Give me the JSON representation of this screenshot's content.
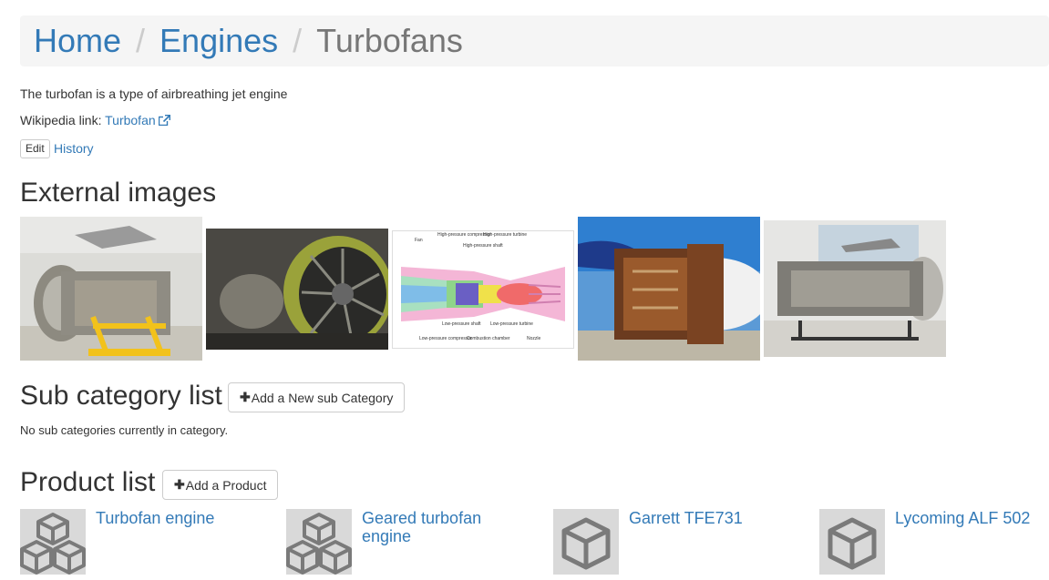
{
  "breadcrumb": {
    "home": "Home",
    "engines": "Engines",
    "separator": "/",
    "current": "Turbofans"
  },
  "description": "The turbofan is a type of airbreathing jet engine",
  "wikipedia": {
    "label": "Wikipedia link:",
    "link_text": "Turbofan",
    "icon": "external-link-icon"
  },
  "actions": {
    "edit": "Edit",
    "history": "History"
  },
  "external_images": {
    "heading": "External images",
    "images": [
      {
        "name": "turbofan-engine-photo-1"
      },
      {
        "name": "turbofan-fan-photo"
      },
      {
        "name": "turbofan-diagram",
        "labels": {
          "fan": "Fan",
          "hpc": "High-pressure compressor",
          "hps": "High-pressure shaft",
          "hpt": "High-pressure turbine",
          "lps": "Low-pressure shaft",
          "lpc": "Low-pressure compressor",
          "cc": "Combustion chamber",
          "lpt": "Low-pressure turbine",
          "nozzle": "Nozzle"
        }
      },
      {
        "name": "engine-on-aircraft-photo"
      },
      {
        "name": "turbofan-engine-photo-2"
      }
    ]
  },
  "sub_category": {
    "heading": "Sub category list",
    "add_button": "Add a New sub Category",
    "empty_text": "No sub categories currently in category."
  },
  "product_list": {
    "heading": "Product list",
    "add_button": "Add a Product",
    "items": [
      {
        "name": "Turbofan engine",
        "icon": "cubes-icon"
      },
      {
        "name": "Geared turbofan engine",
        "icon": "cubes-icon"
      },
      {
        "name": "Garrett TFE731",
        "icon": "cube-icon"
      },
      {
        "name": "Lycoming ALF 502",
        "icon": "cube-icon"
      }
    ]
  },
  "colors": {
    "link": "#337ab7",
    "breadcrumb_bg": "#f5f5f5",
    "thumb_bg": "#d9d9d9",
    "icon_gray": "#7a7a7a"
  }
}
